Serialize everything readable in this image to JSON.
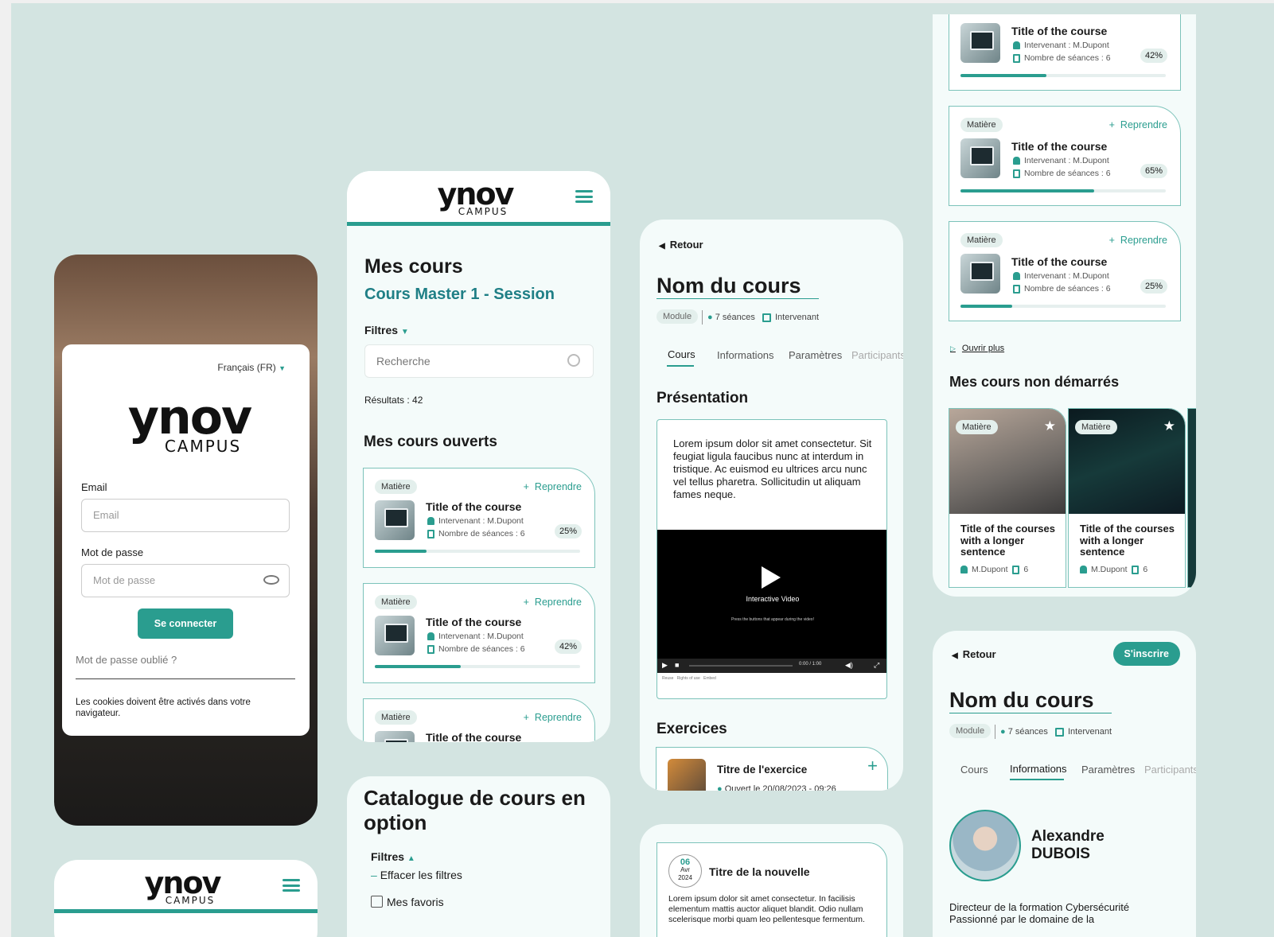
{
  "brand": {
    "logo_word": "ynov",
    "logo_sub": "CAMPUS",
    "accent": "#2a9d8f",
    "background": "#d3e4e1"
  },
  "login": {
    "language": "Français (FR)",
    "email_label": "Email",
    "email_placeholder": "Email",
    "password_label": "Mot de passe",
    "password_placeholder": "Mot de passe",
    "submit": "Se connecter",
    "forgot": "Mot de passe oublié ?",
    "cookies": "Les cookies doivent être activés dans votre navigateur."
  },
  "courses": {
    "title": "Mes cours",
    "subtitle": "Cours Master 1 - Session",
    "filters": "Filtres",
    "search_placeholder": "Recherche",
    "results": "Résultats : 42",
    "open_section": "Mes cours ouverts",
    "cards": [
      {
        "chip": "Matière",
        "action": "Reprendre",
        "title": "Title of the course",
        "teacher": "Intervenant : M.Dupont",
        "sessions": "Nombre de séances : 6",
        "progress": "25%",
        "progress_value": 0.25
      },
      {
        "chip": "Matière",
        "action": "Reprendre",
        "title": "Title of the course",
        "teacher": "Intervenant : M.Dupont",
        "sessions": "Nombre de séances : 6",
        "progress": "42%",
        "progress_value": 0.42
      },
      {
        "chip": "Matière",
        "action": "Reprendre",
        "title": "Title of the course"
      }
    ]
  },
  "catalogue": {
    "title": "Catalogue de cours en option",
    "filters": "Filtres",
    "clear": "Effacer les filtres",
    "favorites": "Mes favoris"
  },
  "course_detail": {
    "back": "Retour",
    "title": "Nom du cours",
    "module": "Module",
    "sessions": "7 séances",
    "teacher": "Intervenant",
    "tabs": [
      "Cours",
      "Informations",
      "Paramètres",
      "Participants"
    ],
    "presentation_title": "Présentation",
    "presentation_text": "Lorem ipsum dolor sit amet consectetur. Sit feugiat ligula faucibus nunc at interdum in tristique. Ac euismod eu ultrices arcu nunc vel tellus pharetra. Sollicitudin ut aliquam fames neque.",
    "video_title": "Interactive Video",
    "video_hint": "Press the buttons that appear during the video!",
    "video_time": "0:00 / 1:00",
    "video_links": [
      "Reuse",
      "Rights of use",
      "Embed"
    ],
    "exercises_title": "Exercices",
    "exercise_name": "Titre de l'exercice",
    "exercise_status": "Ouvert le 20/08/2023 - 09:26"
  },
  "news": {
    "day": "06",
    "month": "Avr",
    "year": "2024",
    "title": "Titre de la nouvelle",
    "text": "Lorem ipsum dolor sit amet consectetur. In facilisis elementum mattis auctor aliquet blandit. Odio nullam scelerisque morbi quam leo pellentesque fermentum."
  },
  "progress_list": {
    "cards": [
      {
        "title": "Title of the course",
        "teacher": "Intervenant : M.Dupont",
        "sessions": "Nombre de séances : 6",
        "progress": "42%",
        "progress_value": 0.42
      },
      {
        "chip": "Matière",
        "action": "Reprendre",
        "title": "Title of the course",
        "teacher": "Intervenant : M.Dupont",
        "sessions": "Nombre de séances : 6",
        "progress": "65%",
        "progress_value": 0.65
      },
      {
        "chip": "Matière",
        "action": "Reprendre",
        "title": "Title of the course",
        "teacher": "Intervenant : M.Dupont",
        "sessions": "Nombre de séances : 6",
        "progress": "25%",
        "progress_value": 0.25
      }
    ],
    "open_more": "Ouvrir plus",
    "not_started_title": "Mes cours non démarrés",
    "tiles": [
      {
        "chip": "Matière",
        "title": "Title of the courses with a longer sentence",
        "teacher": "M.Dupont",
        "count": "6"
      },
      {
        "chip": "Matière",
        "title": "Title of the courses with a longer sentence",
        "teacher": "M.Dupont",
        "count": "6"
      }
    ]
  },
  "course_info": {
    "back": "Retour",
    "register": "S'inscrire",
    "title": "Nom du cours",
    "module": "Module",
    "sessions": "7 séances",
    "teacher": "Intervenant",
    "tabs": [
      "Cours",
      "Informations",
      "Paramètres",
      "Participants"
    ],
    "person_first": "Alexandre",
    "person_last": "DUBOIS",
    "bio": "Directeur de la formation Cybersécurité Passionné par le domaine de la"
  }
}
